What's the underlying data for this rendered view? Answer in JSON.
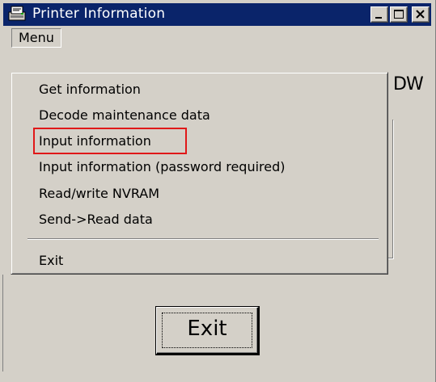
{
  "window": {
    "title": "Printer Information"
  },
  "menubar": {
    "menu_label": "Menu"
  },
  "background": {
    "partial_text": "DW"
  },
  "dropdown": {
    "items": [
      {
        "label": "Get information"
      },
      {
        "label": "Decode maintenance data"
      },
      {
        "label": "Input information",
        "highlighted": true
      },
      {
        "label": "Input information (password required)"
      },
      {
        "label": "Read/write NVRAM"
      },
      {
        "label": "Send->Read data"
      },
      {
        "label": "Exit"
      }
    ],
    "highlight_color": "#e01818"
  },
  "buttons": {
    "exit_label": "Exit"
  },
  "colors": {
    "titlebar": "#0a246a",
    "face": "#d4d0c8"
  },
  "icons": [
    "printer-icon",
    "minimize-icon",
    "maximize-icon",
    "close-icon"
  ]
}
